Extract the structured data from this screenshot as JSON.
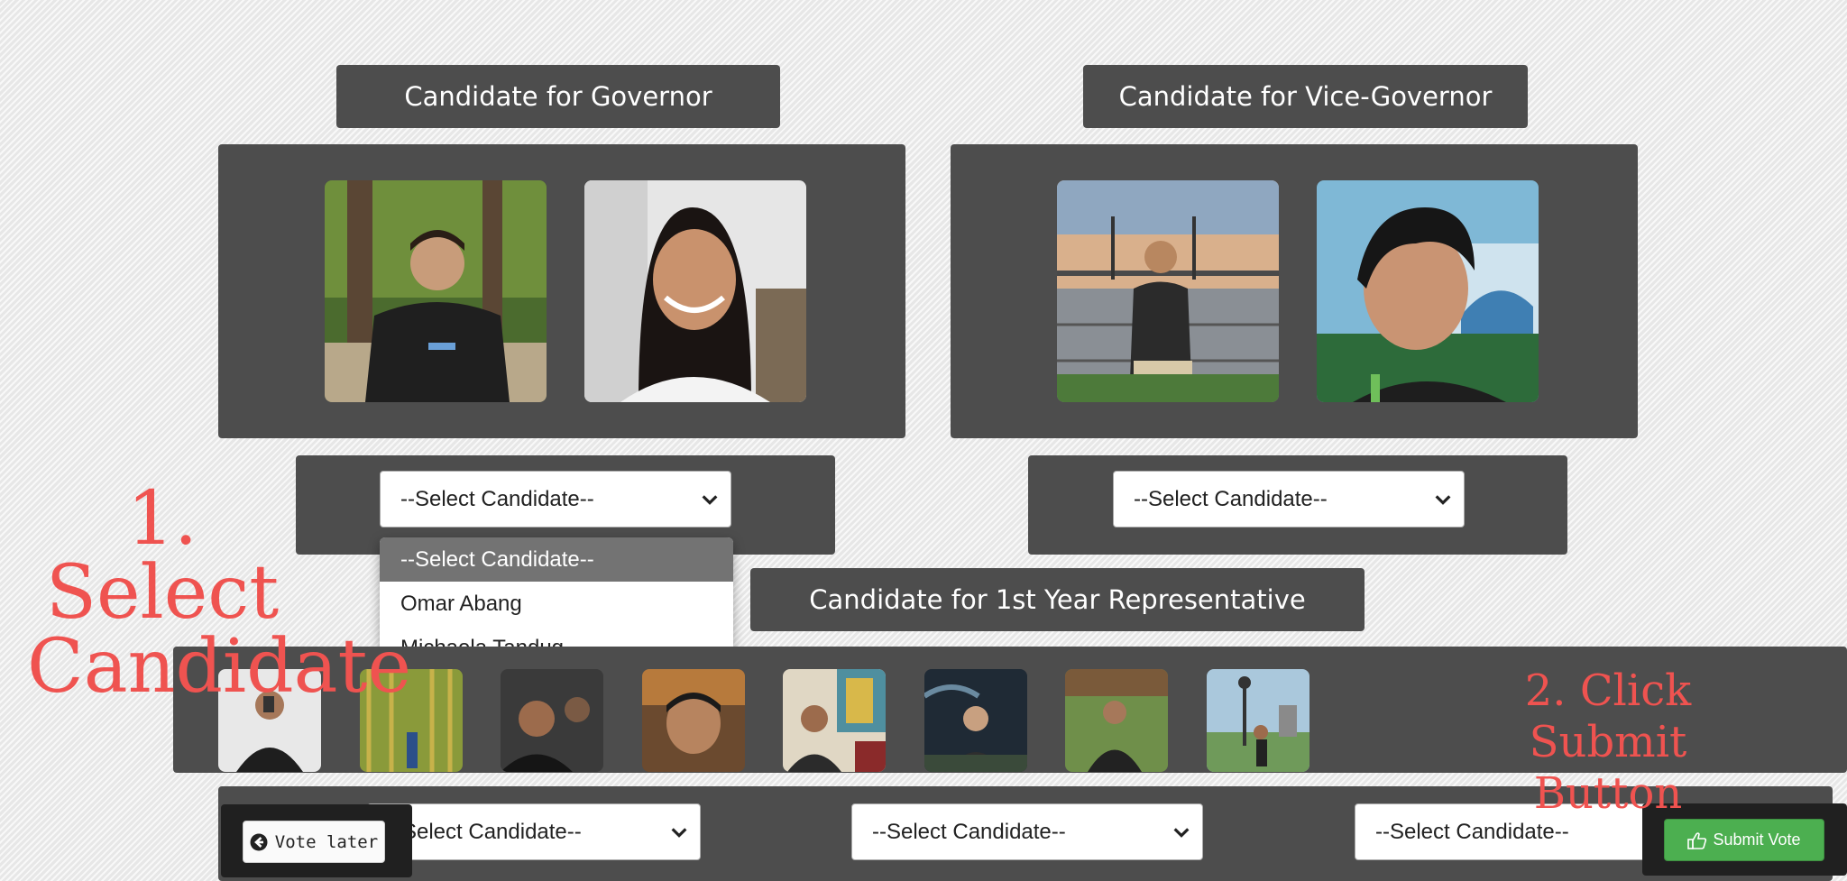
{
  "governor": {
    "title": "Candidate for Governor",
    "select_value": "--Select Candidate--",
    "dropdown_options": [
      "--Select Candidate--",
      "Omar Abang",
      "Michaela Tandug"
    ]
  },
  "vice_governor": {
    "title": "Candidate for Vice-Governor",
    "select_value": "--Select Candidate--"
  },
  "first_year_rep": {
    "title": "Candidate for 1st Year Representative",
    "select_values": [
      "--Select Candidate--",
      "--Select Candidate--",
      "--Select Candidate--"
    ]
  },
  "annotations": {
    "step1_line1": "1. Select",
    "step1_line2": "Candidate",
    "step2_line1": "2. Click Submit",
    "step2_line2": "Button"
  },
  "buttons": {
    "vote_later": "Vote later",
    "submit_vote": "Submit Vote"
  },
  "colors": {
    "panel": "#4d4d4d",
    "annotation": "#ef5350",
    "submit": "#4caf50"
  },
  "icons": [
    "chevron-down-icon",
    "arrow-left-circle-icon",
    "thumbs-up-icon"
  ]
}
